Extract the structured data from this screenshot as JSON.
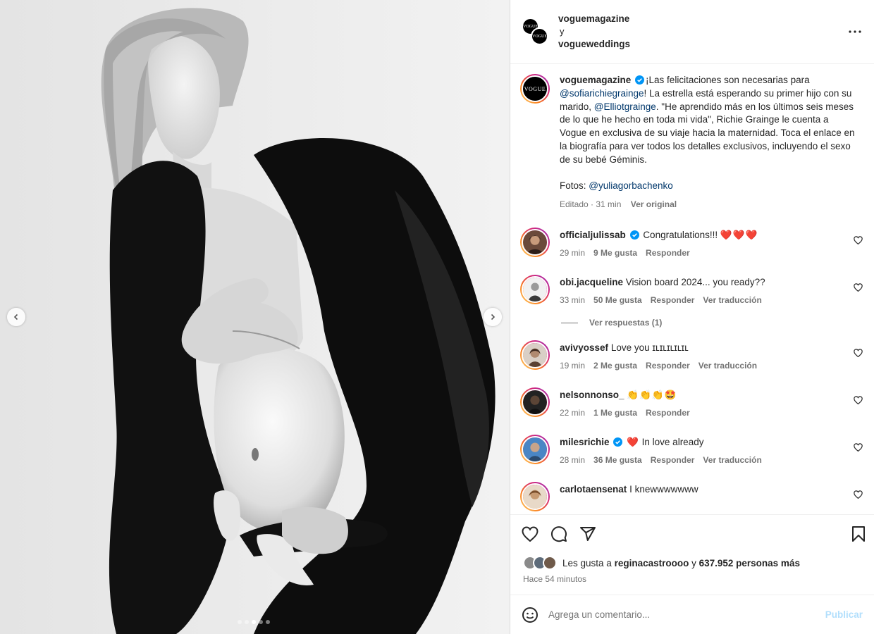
{
  "header": {
    "author1": "voguemagazine",
    "conjunction": "y",
    "author2": "vogueweddings"
  },
  "brand": {
    "logo_text": "VOGUE"
  },
  "caption": {
    "username": "voguemagazine",
    "text_before": "¡Las felicitaciones son necesarias para ",
    "mention1": "@sofiarichiegrainge",
    "text_mid": "! La estrella está esperando su primer hijo con su marido, ",
    "mention2": "@Elliotgrainge",
    "text_after": ". \"He aprendido más en los últimos seis meses de lo que he hecho en toda mi vida\", Richie Grainge le cuenta a Vogue en exclusiva de su viaje hacia la maternidad. Toca el enlace en la biografía para ver todos los detalles exclusivos, incluyendo el sexo de su bebé Géminis.",
    "photos_label": "Fotos: ",
    "photos_mention": "@yuliagorbachenko",
    "edited": "Editado · 31 min",
    "see_original": "Ver original"
  },
  "comments": [
    {
      "username": "officialjulissab",
      "verified": true,
      "text": "Congratulations!!! ",
      "emoji": "❤️❤️❤️",
      "time": "29 min",
      "likes": "9 Me gusta",
      "reply": "Responder",
      "translate": ""
    },
    {
      "username": "obi.jacqueline",
      "verified": false,
      "text": "Vision board 2024... you ready??",
      "emoji": "",
      "time": "33 min",
      "likes": "50 Me gusta",
      "reply": "Responder",
      "translate": "Ver traducción"
    },
    {
      "username": "avivyossef",
      "verified": false,
      "text": "Love you ɪʟɪʟɪʟɪʟɪʟ",
      "emoji": "",
      "time": "19 min",
      "likes": "2 Me gusta",
      "reply": "Responder",
      "translate": "Ver traducción"
    },
    {
      "username": "nelsonnonso_",
      "verified": false,
      "text": "",
      "emoji": "👏👏👏🤩",
      "time": "22 min",
      "likes": "1 Me gusta",
      "reply": "Responder",
      "translate": ""
    },
    {
      "username": "milesrichie",
      "verified": true,
      "text": "In love already",
      "emoji": "❤️",
      "time": "28 min",
      "likes": "36 Me gusta",
      "reply": "Responder",
      "translate": "Ver traducción"
    },
    {
      "username": "carlotaensenat",
      "verified": false,
      "text": "I knewwwwwww",
      "emoji": "",
      "time": "",
      "likes": "",
      "reply": "",
      "translate": ""
    }
  ],
  "replies_toggle": "Ver respuestas (1)",
  "likes_line": {
    "prefix": "Les gusta a ",
    "user": "reginacastroooo",
    "mid": " y ",
    "count": "637.952 personas más"
  },
  "posted_ago": "Hace 54 minutos",
  "composer": {
    "placeholder": "Agrega un comentario...",
    "publish": "Publicar"
  },
  "carousel": {
    "slides": 5,
    "active_slide": 3
  },
  "colors": {
    "verified": "#0095f6",
    "heart": "#ff3040",
    "mention": "#00376b",
    "muted": "#737373",
    "publish": "#b2dffc"
  },
  "icons": [
    "chevron-left-icon",
    "chevron-right-icon",
    "more-icon",
    "heart-icon",
    "comment-icon",
    "share-icon",
    "bookmark-icon",
    "emoji-icon",
    "verified-icon"
  ]
}
